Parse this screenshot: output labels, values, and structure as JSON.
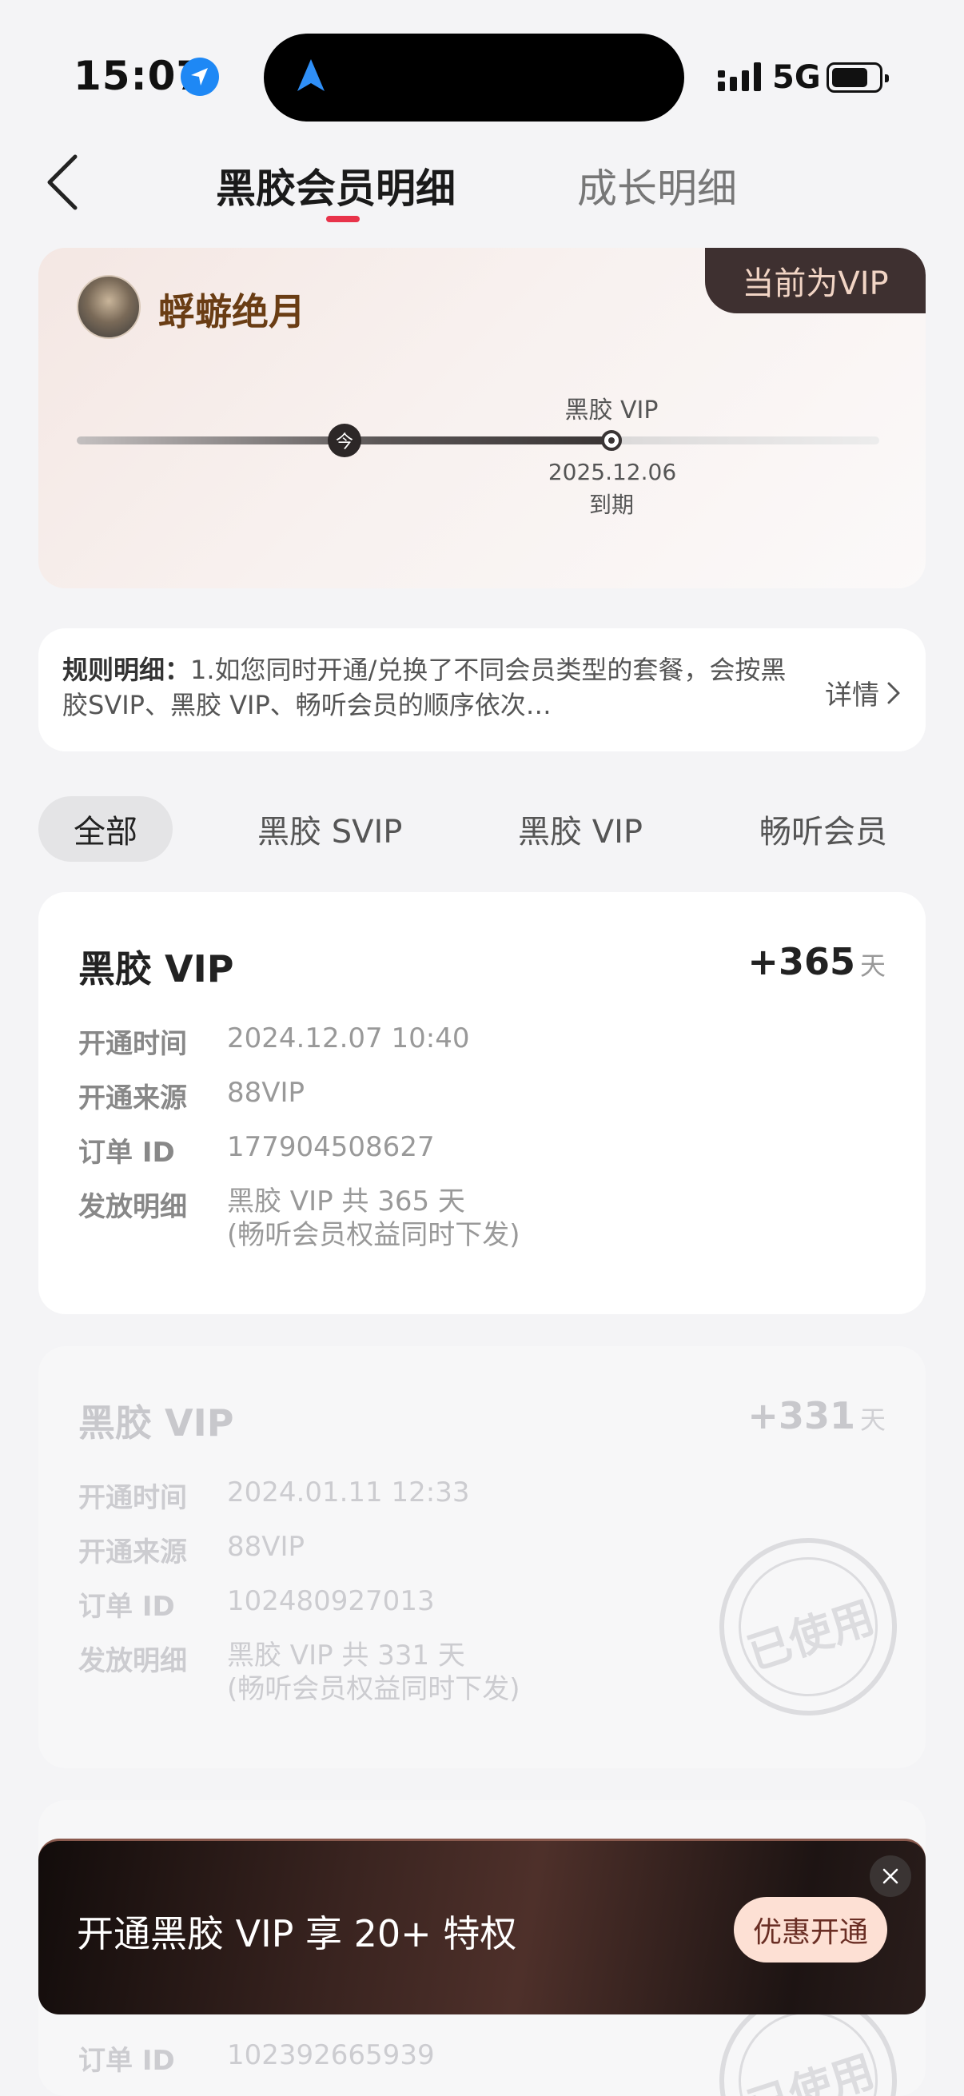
{
  "status_bar": {
    "time": "15:07",
    "network": "5G"
  },
  "nav": {
    "tabs": [
      {
        "label": "黑胶会员明细",
        "active": true
      },
      {
        "label": "成长明细",
        "active": false
      }
    ]
  },
  "vip_card": {
    "badge": "当前为VIP",
    "username": "蜉蝣绝月",
    "today_marker": "今",
    "end_label": "黑胶 VIP",
    "end_date": "2025.12.06",
    "end_note": "到期"
  },
  "rules": {
    "title": "规则明细：",
    "text": "1.如您同时开通/兑换了不同会员类型的套餐，会按黑胶SVIP、黑胶 VIP、畅听会员的顺序依次…",
    "link": "详情"
  },
  "filters": [
    "全部",
    "黑胶 SVIP",
    "黑胶 VIP",
    "畅听会员"
  ],
  "field_labels": {
    "open_time": "开通时间",
    "source": "开通来源",
    "order_id": "订单 ID",
    "detail": "发放明细"
  },
  "records": [
    {
      "title": "黑胶 VIP",
      "days": "+365",
      "unit": "天",
      "open_time": "2024.12.07 10:40",
      "source": "88VIP",
      "order_id": "177904508627",
      "detail_line1": "黑胶 VIP 共 365 天",
      "detail_line2": "(畅听会员权益同时下发)"
    },
    {
      "title": "黑胶 VIP",
      "days": "+331",
      "unit": "天",
      "open_time": "2024.01.11 12:33",
      "source": "88VIP",
      "order_id": "102480927013",
      "detail_line1": "黑胶 VIP 共 331 天",
      "detail_line2": "(畅听会员权益同时下发)",
      "stamp": "已使用"
    },
    {
      "order_id": "102392665939",
      "stamp": "已使用"
    }
  ],
  "promo": {
    "text": "开通黑胶 VIP 享 20+ 特权",
    "button": "优惠开通"
  },
  "colors": {
    "accent": "#e8334a",
    "badge_bg": "#3e3030",
    "badge_text": "#f1d4c4",
    "username": "#6a3d14",
    "promo_button_bg": "#fde0d4"
  }
}
